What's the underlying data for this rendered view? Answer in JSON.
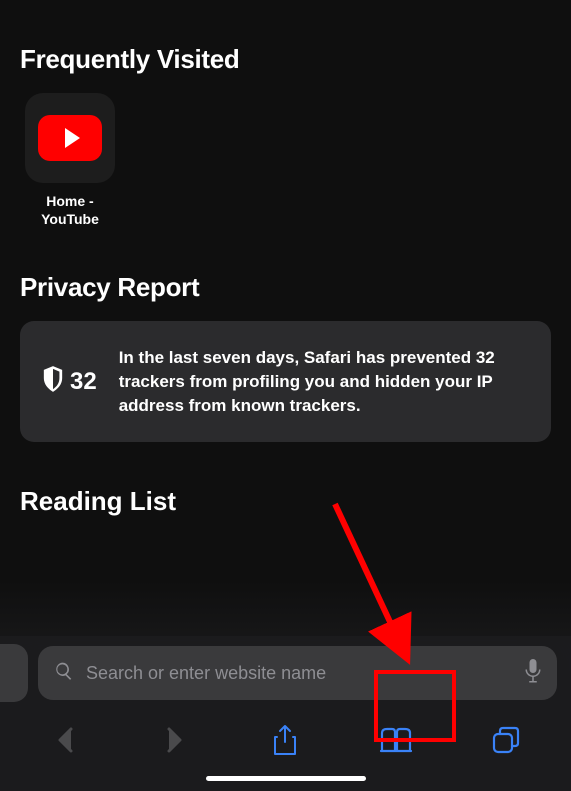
{
  "sections": {
    "frequently_visited": {
      "title": "Frequently Visited",
      "sites": [
        {
          "label": "Home -\nYouTube",
          "name": "youtube"
        }
      ]
    },
    "privacy_report": {
      "title": "Privacy Report",
      "count": "32",
      "text": "In the last seven days, Safari has prevented 32 trackers from profiling you and hidden your IP address from known trackers."
    },
    "reading_list": {
      "title": "Reading List"
    }
  },
  "search": {
    "placeholder": "Search or enter website name"
  },
  "toolbar": {
    "back": "back",
    "forward": "forward",
    "share": "share",
    "bookmarks": "bookmarks",
    "tabs": "tabs"
  },
  "annotation": {
    "highlight_target": "bookmarks-button"
  }
}
